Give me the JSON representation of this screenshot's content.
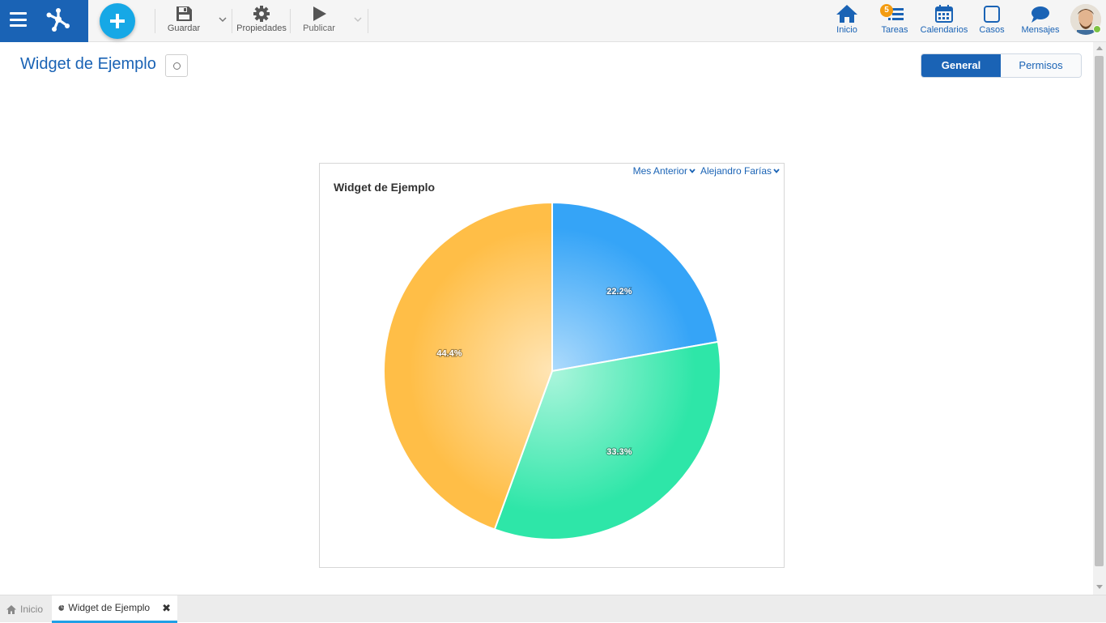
{
  "toolbar": {
    "save_label": "Guardar",
    "properties_label": "Propiedades",
    "publish_label": "Publicar"
  },
  "nav": {
    "home_label": "Inicio",
    "tasks_label": "Tareas",
    "tasks_badge": "5",
    "calendars_label": "Calendarios",
    "cases_label": "Casos",
    "messages_label": "Mensajes"
  },
  "page": {
    "title": "Widget de Ejemplo"
  },
  "tabs": {
    "general": "General",
    "permissions": "Permisos"
  },
  "widget": {
    "title": "Widget de Ejemplo",
    "period_filter": "Mes Anterior",
    "user_filter": "Alejandro Farías"
  },
  "chart_data": {
    "type": "pie",
    "title": "Widget de Ejemplo",
    "values": [
      22.2,
      33.3,
      44.4
    ],
    "labels": [
      "22.2%",
      "33.3%",
      "44.4%"
    ],
    "colors": [
      "#35a4f7",
      "#2ee6a8",
      "#ffbe47"
    ],
    "start_angle_deg": 0,
    "direction": "clockwise"
  },
  "bottom_tabs": {
    "home": "Inicio",
    "current": "Widget de Ejemplo"
  },
  "colors": {
    "brand": "#1a63b5",
    "accent": "#16a8e6",
    "badge": "#f39c12"
  }
}
